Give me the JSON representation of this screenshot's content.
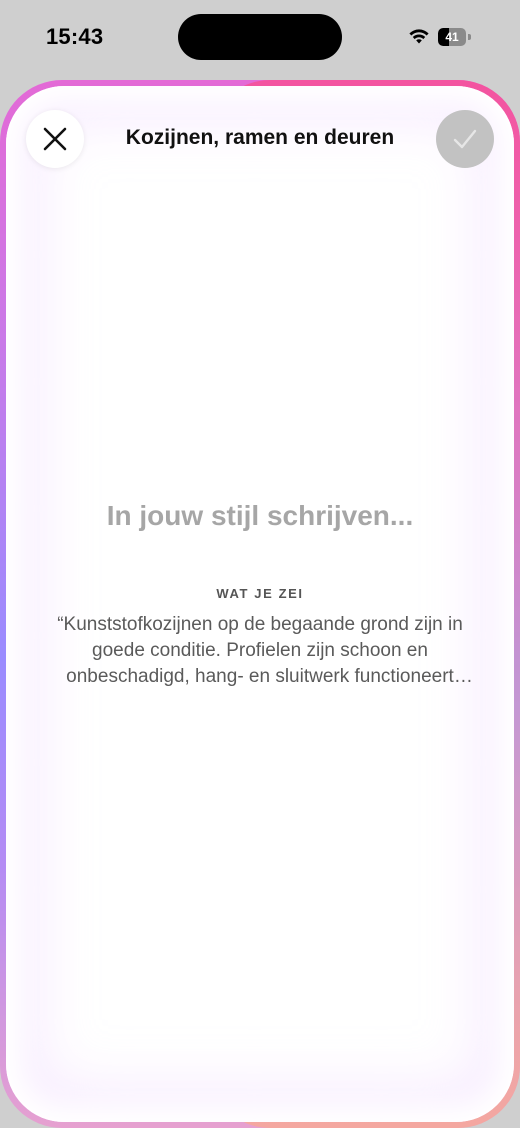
{
  "status_bar": {
    "time": "15:43",
    "battery_level": "41",
    "battery_fraction": 0.41
  },
  "header": {
    "title": "Kozijnen, ramen en deuren",
    "close_icon": "close-icon",
    "confirm_icon": "checkmark-icon"
  },
  "main": {
    "loading_text": "In jouw stijl schrijven...",
    "said_label": "WAT JE ZEI",
    "said_quote": "“Kunststofkozijnen op de begaande grond zijn in goede conditie. Profielen zijn schoon en onbeschadigd, hang- en sluitwerk functioneert goed."
  },
  "colors": {
    "glow_top": "#e36ad6",
    "glow_mid": "#9a8cff",
    "glow_right": "#f65096",
    "confirm_disabled": "#c2c2c2",
    "loading_text": "#a6a6a6"
  }
}
